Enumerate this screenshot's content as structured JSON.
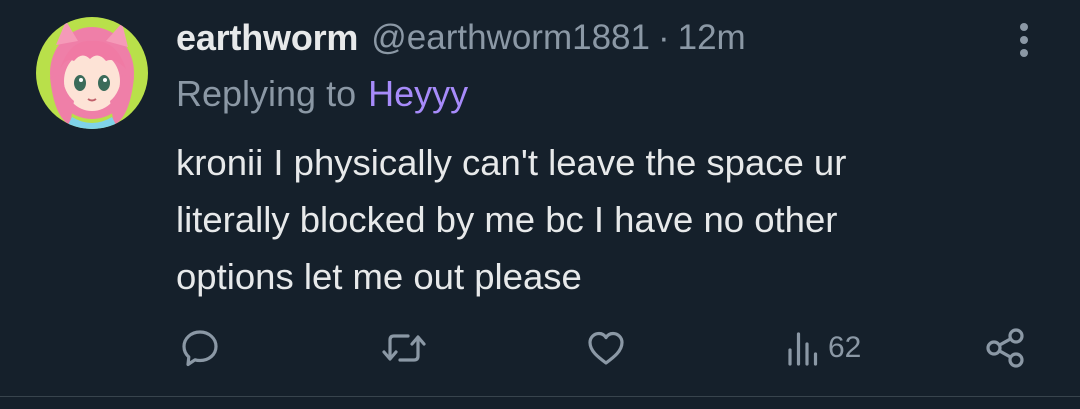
{
  "tweet": {
    "display_name": "earthworm",
    "handle": "@earthworm1881",
    "separator": "·",
    "time": "12m",
    "reply_prefix": "Replying to",
    "reply_target": "Heyyy",
    "text_lines": [
      "kronii I physically can't leave the space ur",
      "literally blocked by me bc I have no other",
      "options let me out please"
    ]
  },
  "actions": {
    "reply_icon": "reply-icon",
    "retweet_icon": "retweet-icon",
    "like_icon": "heart-icon",
    "views_icon": "views-chart-icon",
    "views_count": "62",
    "share_icon": "share-icon"
  },
  "colors": {
    "background": "#15202b",
    "text_primary": "#e7e9ea",
    "text_secondary": "#8b98a5",
    "reply_link": "#a78bfa",
    "icon": "#8b98a5",
    "divider": "#38444d"
  }
}
